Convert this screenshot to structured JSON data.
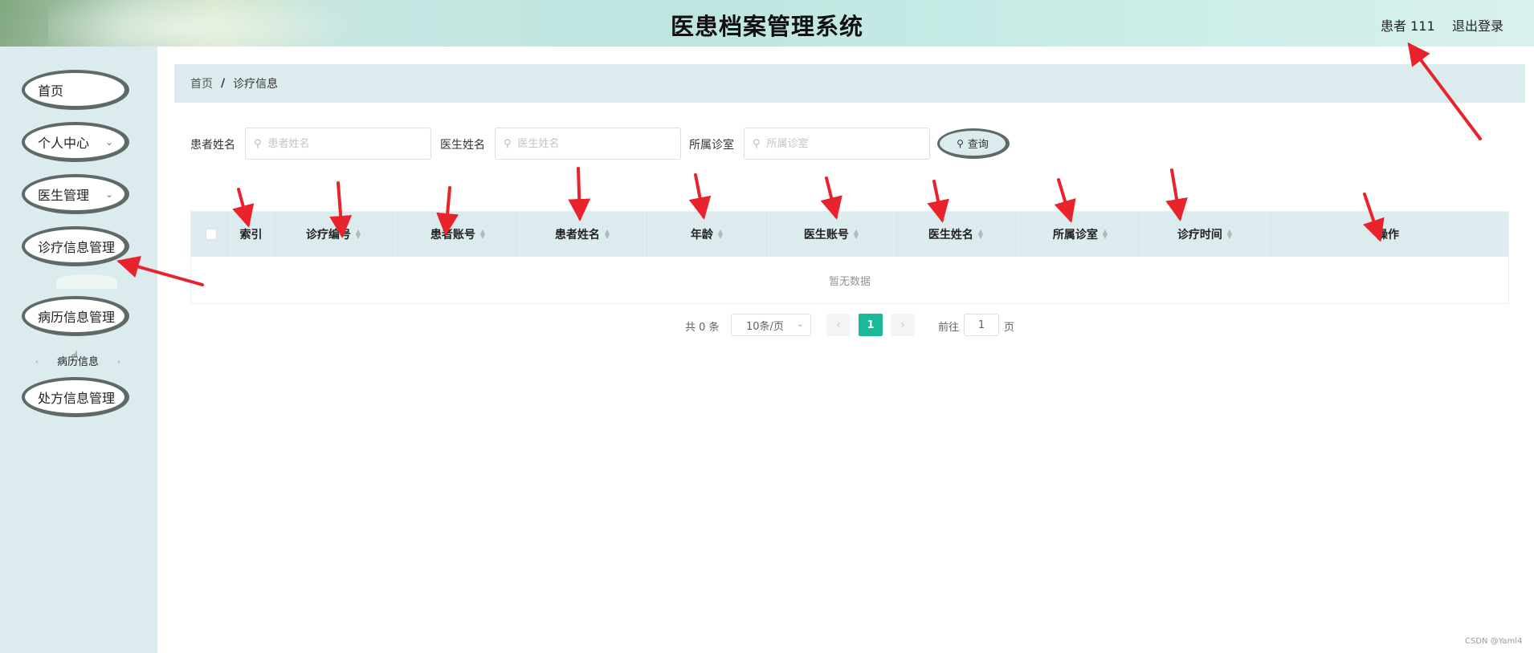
{
  "header": {
    "title": "医患档案管理系统",
    "user": "患者 111",
    "logout": "退出登录"
  },
  "sidebar": {
    "items": [
      {
        "label": "首页"
      },
      {
        "label": "个人中心",
        "chevron": "chevron-down-icon"
      },
      {
        "label": "医生管理",
        "chevron": "chevron-down-icon"
      },
      {
        "label": "诊疗信息管理"
      },
      {
        "label": "病历信息管理"
      },
      {
        "label": "处方信息管理"
      }
    ],
    "submenu_item": "病历信息"
  },
  "breadcrumb": {
    "home": "首页",
    "separator": "/",
    "current": "诊疗信息"
  },
  "search": {
    "patient_label": "患者姓名",
    "patient_placeholder": "患者姓名",
    "doctor_label": "医生姓名",
    "doctor_placeholder": "医生姓名",
    "room_label": "所属诊室",
    "room_placeholder": "所属诊室",
    "button": "查询"
  },
  "table": {
    "columns": [
      "索引",
      "诊疗编号",
      "患者账号",
      "患者姓名",
      "年龄",
      "医生账号",
      "医生姓名",
      "所属诊室",
      "诊疗时间",
      "操作"
    ],
    "empty_text": "暂无数据"
  },
  "pagination": {
    "total": "共 0 条",
    "page_size": "10条/页",
    "current_page": "1",
    "goto_label": "前往",
    "goto_value": "1",
    "unit": "页"
  },
  "watermark": "CSDN @Yaml4",
  "colors": {
    "accent": "#1bb99a",
    "panel": "#dcebed",
    "annotation": "#e8232b"
  }
}
